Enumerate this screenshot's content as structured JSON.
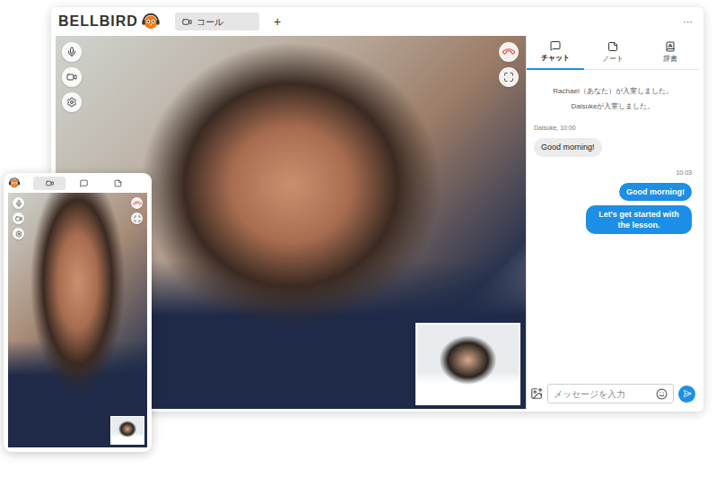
{
  "app": {
    "logo": "BELLBIRD",
    "tabs": [
      {
        "label": "コール",
        "selected": true
      }
    ],
    "add_tab": "+",
    "menu": "···"
  },
  "chat_panel": {
    "tabs": [
      {
        "label": "チャット",
        "kind": "chat",
        "selected": true
      },
      {
        "label": "ノート",
        "kind": "note",
        "selected": false
      },
      {
        "label": "辞書",
        "kind": "dictionary",
        "selected": false
      }
    ],
    "messages": [
      {
        "kind": "system",
        "text": "Rachael（あなた）が入室しました。"
      },
      {
        "kind": "system",
        "text": "Daisukeが入室しました。"
      },
      {
        "kind": "sender",
        "text": "Daisuke, 10:00"
      },
      {
        "kind": "incoming",
        "text": "Good morning!"
      },
      {
        "kind": "time",
        "text": "10:03"
      },
      {
        "kind": "outgoing",
        "text": "Good morning!"
      },
      {
        "kind": "outgoing",
        "text": "Let's get started with the lesson."
      }
    ],
    "input": {
      "placeholder": "メッセージを入力"
    }
  },
  "phone": {
    "tabs": [
      {
        "kind": "video",
        "selected": true
      },
      {
        "kind": "chat",
        "selected": false
      },
      {
        "kind": "note",
        "selected": false
      }
    ]
  }
}
